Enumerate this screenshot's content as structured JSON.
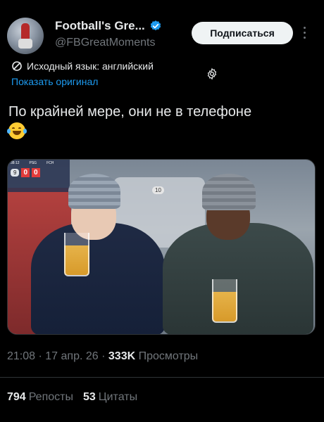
{
  "account": {
    "name": "Football's Gre...",
    "handle": "@FBGreatMoments",
    "verified_color": "#1d9bf0"
  },
  "follow_button": {
    "label": "Подписаться"
  },
  "translation": {
    "source_label": "Исходный язык: английский",
    "show_original": "Показать оригинал"
  },
  "tweet": {
    "text": "По крайней мере, они не в телефоне",
    "emoji": "face-with-tears-of-joy"
  },
  "media": {
    "scoreboard": {
      "clock": "38:12",
      "team1": "PSG",
      "team2": "FCH",
      "score1": "0",
      "score2": "0",
      "minute": "9"
    },
    "seat_number": "10"
  },
  "meta": {
    "time": "21:08",
    "date": "17 апр. 26",
    "views_count": "333K",
    "views_label": "Просмотры"
  },
  "stats": {
    "reposts_count": "794",
    "reposts_label": "Репосты",
    "quotes_count": "53",
    "quotes_label": "Цитаты"
  },
  "colors": {
    "background": "#000000",
    "accent": "#1d9bf0",
    "muted": "#71767b",
    "text": "#e7e9ea"
  }
}
